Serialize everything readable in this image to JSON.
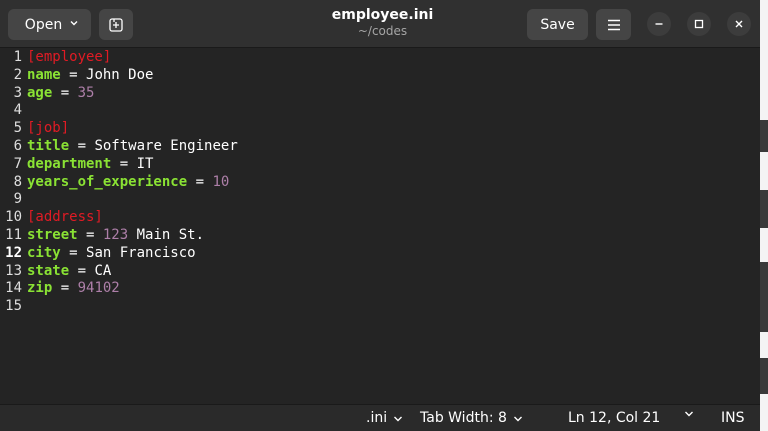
{
  "header": {
    "open_label": "Open",
    "title": "employee.ini",
    "subtitle": "~/codes",
    "save_label": "Save"
  },
  "editor": {
    "current_line": 12,
    "lines": [
      {
        "n": "1",
        "tokens": [
          {
            "c": "sec",
            "t": "[employee]"
          }
        ]
      },
      {
        "n": "2",
        "tokens": [
          {
            "c": "key",
            "t": "name"
          },
          {
            "c": "op",
            "t": " = "
          },
          {
            "c": "str",
            "t": "John Doe"
          }
        ]
      },
      {
        "n": "3",
        "tokens": [
          {
            "c": "key",
            "t": "age"
          },
          {
            "c": "op",
            "t": " = "
          },
          {
            "c": "num",
            "t": "35"
          }
        ]
      },
      {
        "n": "4",
        "tokens": []
      },
      {
        "n": "5",
        "tokens": [
          {
            "c": "sec",
            "t": "[job]"
          }
        ]
      },
      {
        "n": "6",
        "tokens": [
          {
            "c": "key",
            "t": "title"
          },
          {
            "c": "op",
            "t": " = "
          },
          {
            "c": "str",
            "t": "Software Engineer"
          }
        ]
      },
      {
        "n": "7",
        "tokens": [
          {
            "c": "key",
            "t": "department"
          },
          {
            "c": "op",
            "t": " = "
          },
          {
            "c": "str",
            "t": "IT"
          }
        ]
      },
      {
        "n": "8",
        "tokens": [
          {
            "c": "key",
            "t": "years_of_experience"
          },
          {
            "c": "op",
            "t": " = "
          },
          {
            "c": "num",
            "t": "10"
          }
        ]
      },
      {
        "n": "9",
        "tokens": []
      },
      {
        "n": "10",
        "tokens": [
          {
            "c": "sec",
            "t": "[address]"
          }
        ]
      },
      {
        "n": "11",
        "tokens": [
          {
            "c": "key",
            "t": "street"
          },
          {
            "c": "op",
            "t": " = "
          },
          {
            "c": "num",
            "t": "123"
          },
          {
            "c": "str",
            "t": " Main St."
          }
        ]
      },
      {
        "n": "12",
        "tokens": [
          {
            "c": "key",
            "t": "city"
          },
          {
            "c": "op",
            "t": " = "
          },
          {
            "c": "str",
            "t": "San Francisco"
          }
        ]
      },
      {
        "n": "13",
        "tokens": [
          {
            "c": "key",
            "t": "state"
          },
          {
            "c": "op",
            "t": " = "
          },
          {
            "c": "str",
            "t": "CA"
          }
        ]
      },
      {
        "n": "14",
        "tokens": [
          {
            "c": "key",
            "t": "zip"
          },
          {
            "c": "op",
            "t": " = "
          },
          {
            "c": "num",
            "t": "94102"
          }
        ]
      },
      {
        "n": "15",
        "tokens": []
      }
    ]
  },
  "statusbar": {
    "language": ".ini",
    "tab_width": "Tab Width: 8",
    "position": "Ln 12, Col 21",
    "insert_mode": "INS"
  },
  "icons": {
    "new_tab": "new-tab-icon",
    "menu": "hamburger-menu-icon",
    "minimize": "minimize-icon",
    "maximize": "maximize-icon",
    "close": "close-icon",
    "dropdown": "chevron-down-icon"
  },
  "colors": {
    "section": "#e01b24",
    "key": "#8ae234",
    "number": "#ad7fa8",
    "background": "#242424",
    "headerbar": "#303030"
  }
}
